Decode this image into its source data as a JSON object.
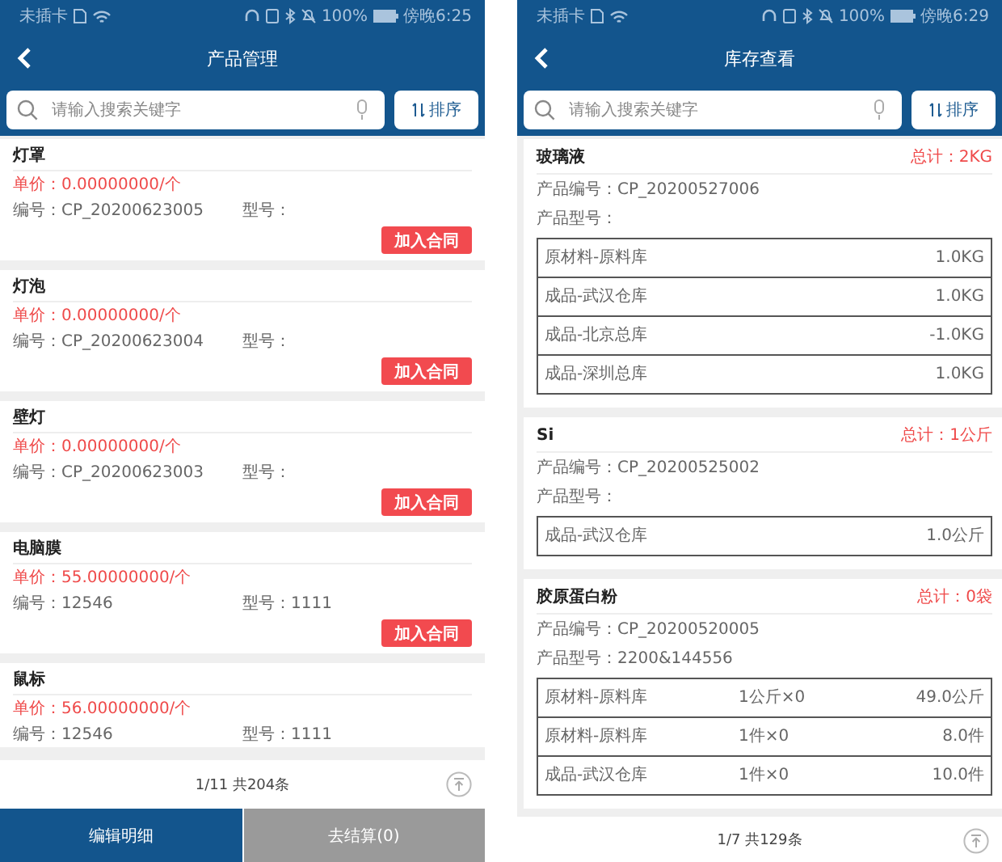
{
  "screens": [
    {
      "kind": "products",
      "status_bar": {
        "carrier": "未插卡",
        "battery": "100%",
        "time": "傍晚6:25"
      },
      "title": "产品管理",
      "search": {
        "placeholder": "请输入搜索关键字"
      },
      "sort_button": "排序",
      "products": [
        {
          "name": "灯罩",
          "price": "单价：0.00000000/个",
          "code": "编号：CP_20200623005",
          "model": "型号：",
          "action": "加入合同"
        },
        {
          "name": "灯泡",
          "price": "单价：0.00000000/个",
          "code": "编号：CP_20200623004",
          "model": "型号：",
          "action": "加入合同"
        },
        {
          "name": "壁灯",
          "price": "单价：0.00000000/个",
          "code": "编号：CP_20200623003",
          "model": "型号：",
          "action": "加入合同"
        },
        {
          "name": "电脑膜",
          "price": "单价：55.00000000/个",
          "code": "编号：12546",
          "model": "型号：1111",
          "action": "加入合同"
        },
        {
          "name": "鼠标",
          "price": "单价：56.00000000/个",
          "code": "编号：12546",
          "model": "型号：1111"
        }
      ],
      "pagination": "1/11 共204条",
      "footer_buttons": [
        {
          "label": "编辑明细",
          "kind": "primary"
        },
        {
          "label": "去结算(0)",
          "kind": "secondary"
        }
      ]
    },
    {
      "kind": "stock",
      "status_bar": {
        "carrier": "未插卡",
        "battery": "100%",
        "time": "傍晚6:29"
      },
      "title": "库存查看",
      "search": {
        "placeholder": "请输入搜索关键字"
      },
      "sort_button": "排序",
      "items": [
        {
          "name": "玻璃液",
          "total": "总计：2KG",
          "code": "产品编号：CP_20200527006",
          "model": "产品型号：",
          "rows": [
            {
              "warehouse": "原材料-原料库",
              "quantity": "1.0KG"
            },
            {
              "warehouse": "成品-武汉仓库",
              "quantity": "1.0KG"
            },
            {
              "warehouse": "成品-北京总库",
              "quantity": "-1.0KG"
            },
            {
              "warehouse": "成品-深圳总库",
              "quantity": "1.0KG"
            }
          ]
        },
        {
          "name": "Si",
          "total": "总计：1公斤",
          "code": "产品编号：CP_20200525002",
          "model": "产品型号：",
          "rows": [
            {
              "warehouse": "成品-武汉仓库",
              "quantity": "1.0公斤"
            }
          ]
        },
        {
          "name": "胶原蛋白粉",
          "total": "总计：0袋",
          "code": "产品编号：CP_20200520005",
          "model": "产品型号：2200&144556",
          "rows": [
            {
              "warehouse": "原材料-原料库",
              "unit": "1公斤×0",
              "quantity": "49.0公斤"
            },
            {
              "warehouse": "原材料-原料库",
              "unit": "1件×0",
              "quantity": "8.0件"
            },
            {
              "warehouse": "成品-武汉仓库",
              "unit": "1件×0",
              "quantity": "10.0件"
            }
          ]
        }
      ],
      "pagination": "1/7 共129条"
    }
  ]
}
